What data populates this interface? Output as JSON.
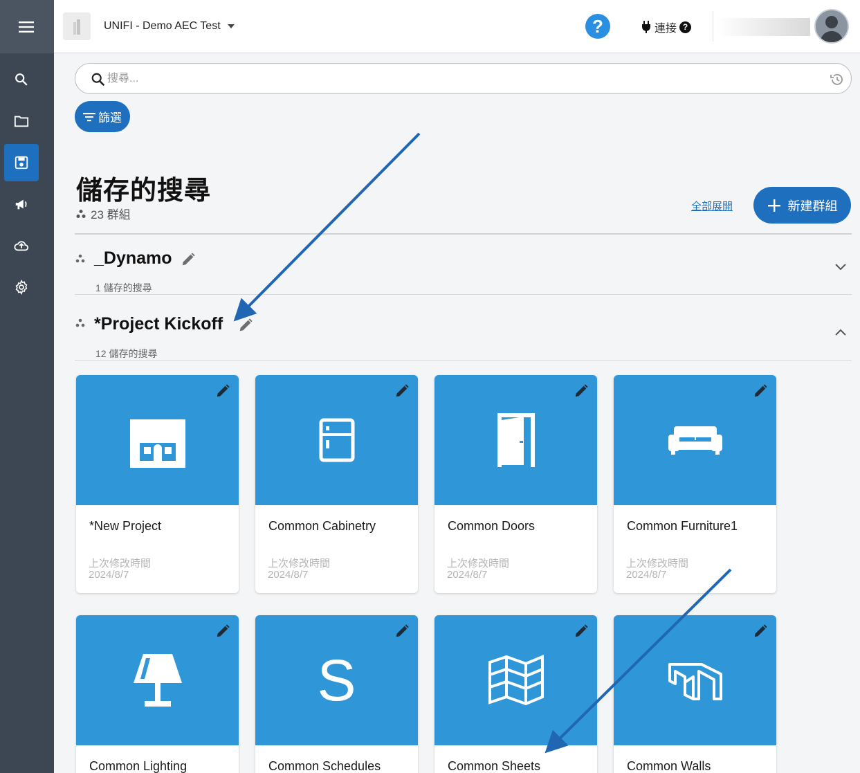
{
  "topbar": {
    "project_name": "UNIFI - Demo AEC Test",
    "help": "?",
    "connect_label": "連接",
    "connect_help": "?"
  },
  "sidebar": {
    "items": [
      {
        "icon": "search-icon"
      },
      {
        "icon": "folder-icon"
      },
      {
        "icon": "saved-search-icon",
        "active": true
      },
      {
        "icon": "megaphone-icon"
      },
      {
        "icon": "cloud-upload-icon"
      },
      {
        "icon": "gear-icon"
      }
    ]
  },
  "search": {
    "placeholder": "搜尋..."
  },
  "filter_label": "篩選",
  "page": {
    "title": "儲存的搜尋",
    "group_count": "23 群組",
    "expand_all": "全部展開",
    "new_group": "新建群組"
  },
  "groups": [
    {
      "title": "_Dynamo",
      "subtitle": "1 儲存的搜尋",
      "expanded": false
    },
    {
      "title": "*Project Kickoff",
      "subtitle": "12 儲存的搜尋",
      "expanded": true
    }
  ],
  "cards": [
    {
      "name": "*New Project",
      "meta_label": "上次修改時間",
      "date": "2024/8/7",
      "icon": "house-icon"
    },
    {
      "name": "Common Cabinetry",
      "meta_label": "上次修改時間",
      "date": "2024/8/7",
      "icon": "cabinet-icon"
    },
    {
      "name": "Common Doors",
      "meta_label": "上次修改時間",
      "date": "2024/8/7",
      "icon": "door-icon"
    },
    {
      "name": "Common Furniture1",
      "meta_label": "上次修改時間",
      "date": "2024/8/7",
      "icon": "sofa-icon"
    },
    {
      "name": "Common Lighting",
      "icon": "lamp-icon"
    },
    {
      "name": "Common Schedules",
      "icon": "schedule-s-icon",
      "glyph": "S"
    },
    {
      "name": "Common Sheets",
      "icon": "sheets-map-icon"
    },
    {
      "name": "Common Walls",
      "icon": "walls-icon"
    }
  ],
  "colors": {
    "sidebar": "#3d4753",
    "accent": "#1f6fbf",
    "card_thumb": "#2f97d8",
    "help": "#2a8fe0"
  }
}
